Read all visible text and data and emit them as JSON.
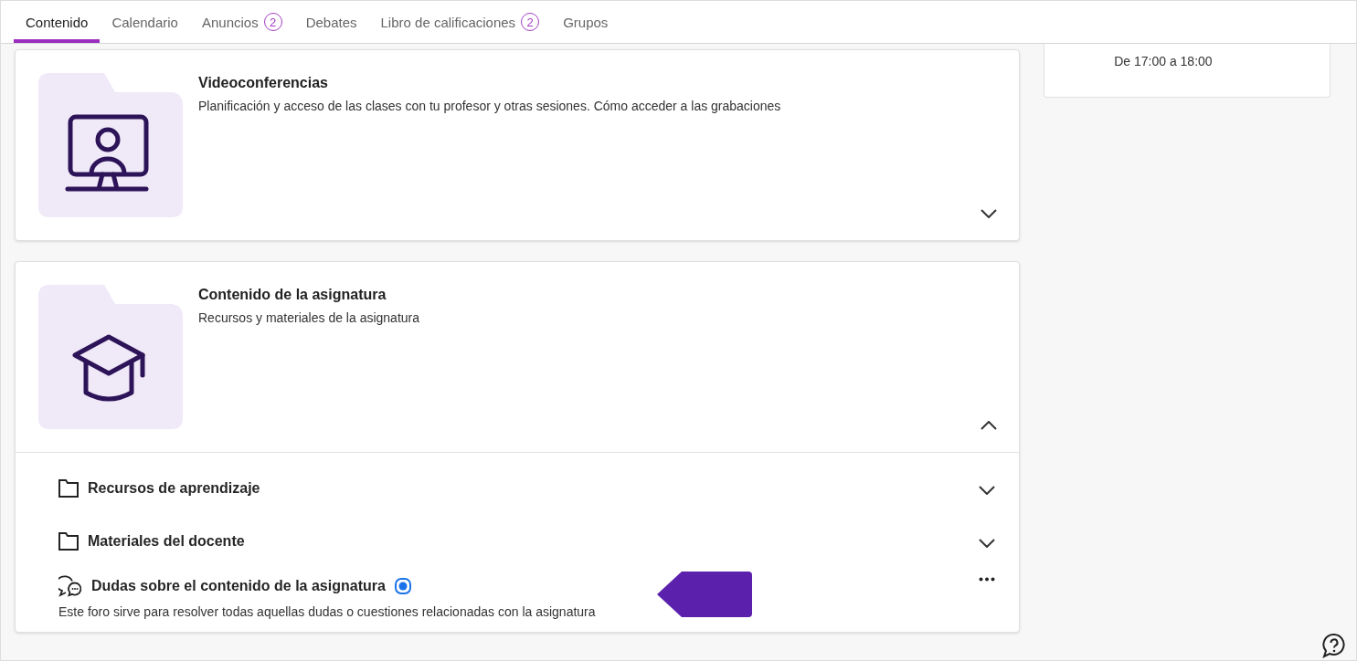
{
  "tabs": [
    {
      "label": "Contenido",
      "selected": true
    },
    {
      "label": "Calendario",
      "selected": false
    },
    {
      "label": "Anuncios",
      "count": "2",
      "selected": false
    },
    {
      "label": "Debates",
      "selected": false
    },
    {
      "label": "Libro de calificaciones",
      "count": "2",
      "selected": false
    },
    {
      "label": "Grupos",
      "selected": false
    }
  ],
  "sections": [
    {
      "kind": "videoconference",
      "title": "Videoconferencias",
      "description": "Planificación y acceso de las clases con tu profesor y otras sesiones. Cómo acceder a las grabaciones",
      "expanded": false
    },
    {
      "kind": "course",
      "title": "Contenido de la asignatura",
      "description": "Recursos y materiales de la asignatura",
      "expanded": true,
      "children": [
        {
          "kind": "folder",
          "title": "Recursos de aprendizaje",
          "expanded": false
        },
        {
          "kind": "folder",
          "title": "Materiales del docente",
          "expanded": false
        },
        {
          "kind": "forum",
          "title": "Dudas sobre el contenido de la asignatura",
          "description": "Este foro sirve para resolver todas aquellas dudas o cuestiones relacionadas con la asignatura",
          "unread": true
        }
      ]
    }
  ],
  "schedule": {
    "time": "De 17:00 a 18:00"
  }
}
